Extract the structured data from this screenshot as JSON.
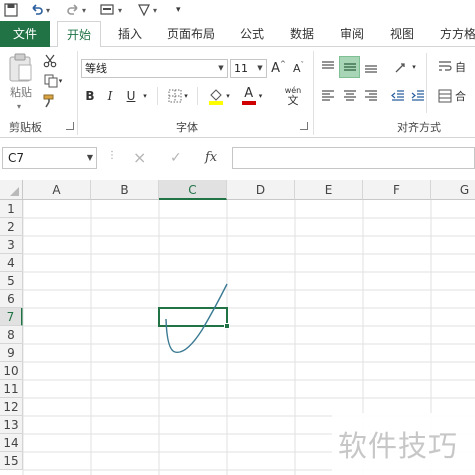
{
  "qat": {
    "undo_icon": "undo-icon",
    "redo_icon": "redo-icon",
    "format_icon": "format-icon",
    "shape_icon": "shape-icon"
  },
  "tabs": [
    {
      "label": "文件"
    },
    {
      "label": "开始"
    },
    {
      "label": "插入"
    },
    {
      "label": "页面布局"
    },
    {
      "label": "公式"
    },
    {
      "label": "数据"
    },
    {
      "label": "审阅"
    },
    {
      "label": "视图"
    },
    {
      "label": "方方格"
    }
  ],
  "ribbon": {
    "clipboard": {
      "paste_label": "粘贴",
      "group_label": "剪贴板"
    },
    "font": {
      "font_name": "等线",
      "font_size": "11",
      "group_label": "字体",
      "bold": "B",
      "italic": "I",
      "underline": "U",
      "grow": "A",
      "shrink": "A",
      "font_color_letter": "A",
      "phonetic_top": "wén",
      "phonetic_bottom": "文"
    },
    "alignment": {
      "group_label": "对齐方式",
      "wrap_label": "自",
      "merge_label": "合"
    }
  },
  "formula_bar": {
    "name_box": "C7",
    "cancel": "×",
    "enter": "✓",
    "fx": "fx",
    "formula": ""
  },
  "grid": {
    "columns": [
      "A",
      "B",
      "C",
      "D",
      "E",
      "F",
      "G"
    ],
    "rows": [
      "1",
      "2",
      "3",
      "4",
      "5",
      "6",
      "7",
      "8",
      "9",
      "10",
      "11",
      "12",
      "13",
      "14",
      "15"
    ],
    "active_cell": "C7"
  },
  "colors": {
    "accent": "#217346",
    "ink_stroke": "#3b7a93"
  },
  "watermark": "软件技巧"
}
